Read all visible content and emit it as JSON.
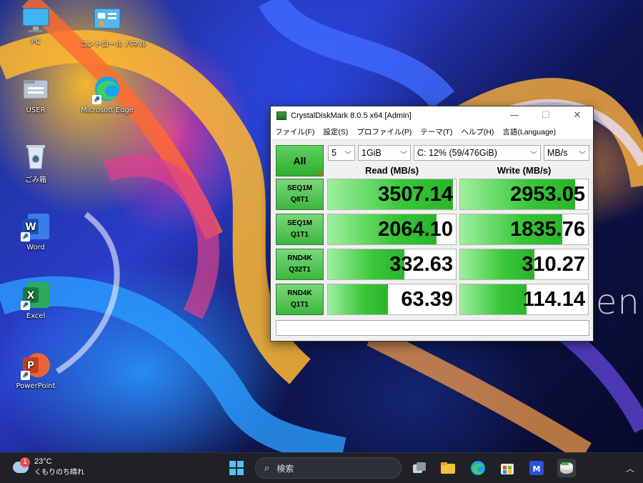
{
  "desktop": {
    "icons": [
      {
        "label": "PC"
      },
      {
        "label": "コントロール パネル"
      },
      {
        "label": "USER"
      },
      {
        "label": "Microsoft Edge"
      },
      {
        "label": "ごみ箱"
      },
      {
        "label": "Word"
      },
      {
        "label": "Excel"
      },
      {
        "label": "PowerPoint"
      }
    ],
    "wallpaper_text": "ZenB"
  },
  "window": {
    "title": "CrystalDiskMark 8.0.5 x64 [Admin]",
    "controls": {
      "minimize": "—",
      "maximize": "☐",
      "close": "✕"
    },
    "menu": [
      "ファイル(F)",
      "設定(S)",
      "プロファイル(P)",
      "テーマ(T)",
      "ヘルプ(H)",
      "言語(Language)"
    ],
    "all_button": "All",
    "selects": {
      "count": "5",
      "size": "1GiB",
      "drive": "C: 12% (59/476GiB)",
      "unit": "MB/s"
    },
    "headers": {
      "read": "Read (MB/s)",
      "write": "Write (MB/s)"
    },
    "rows": [
      {
        "line1": "SEQ1M",
        "line2": "Q8T1",
        "read": "3507.14",
        "write": "2953.05",
        "read_fill": 0.98,
        "write_fill": 0.9
      },
      {
        "line1": "SEQ1M",
        "line2": "Q1T1",
        "read": "2064.10",
        "write": "1835.76",
        "read_fill": 0.85,
        "write_fill": 0.8
      },
      {
        "line1": "RND4K",
        "line2": "Q32T1",
        "read": "332.63",
        "write": "310.27",
        "read_fill": 0.6,
        "write_fill": 0.58
      },
      {
        "line1": "RND4K",
        "line2": "Q1T1",
        "read": "63.39",
        "write": "114.14",
        "read_fill": 0.47,
        "write_fill": 0.52
      }
    ],
    "comment": ""
  },
  "taskbar": {
    "weather": {
      "badge": "1",
      "temp": "23°C",
      "desc": "くもりのち晴れ"
    },
    "search_placeholder": "検索",
    "overflow_icon": "chevron-up-icon"
  }
}
